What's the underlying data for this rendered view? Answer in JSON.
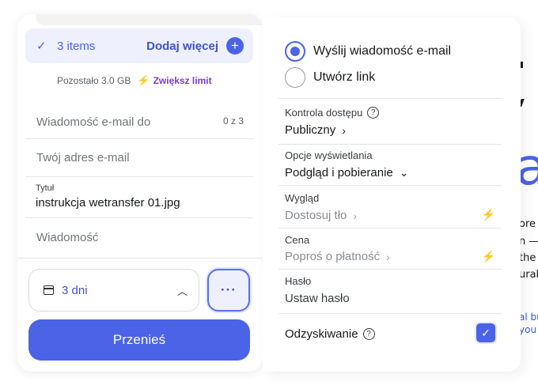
{
  "left": {
    "items_label": "3 items",
    "add_more": "Dodaj więcej",
    "remaining": "Pozostało 3.0 GB",
    "increase_limit": "Zwiększ limit",
    "email_to_placeholder": "Wiadomość e-mail do",
    "email_counter": "0 z 3",
    "your_email_placeholder": "Twój adres e-mail",
    "title_label": "Tytuł",
    "title_value": "instrukcja wetransfer 01.jpg",
    "message_placeholder": "Wiadomość",
    "expiry": "3 dni",
    "transfer_button": "Przenieś"
  },
  "right": {
    "send_option": "Wyślij wiadomość e-mail",
    "link_option": "Utwórz link",
    "access_label": "Kontrola dostępu",
    "access_value": "Publiczny",
    "display_label": "Opcje wyświetlania",
    "display_value": "Podgląd i pobieranie",
    "appearance_label": "Wygląd",
    "appearance_value": "Dostosuj tło",
    "price_label": "Cena",
    "price_value": "Poproś o płatność",
    "password_label": "Hasło",
    "password_value": "Ustaw hasło",
    "recovery_label": "Odzyskiwanie",
    "recovery_checked": true
  },
  "background": {
    "line1": "ore p",
    "line2": "n —",
    "line3": "the",
    "line4": "urab",
    "link1": "al bu",
    "link2": "you"
  },
  "colors": {
    "accent": "#4a63e7",
    "premium": "#8a3de0"
  }
}
